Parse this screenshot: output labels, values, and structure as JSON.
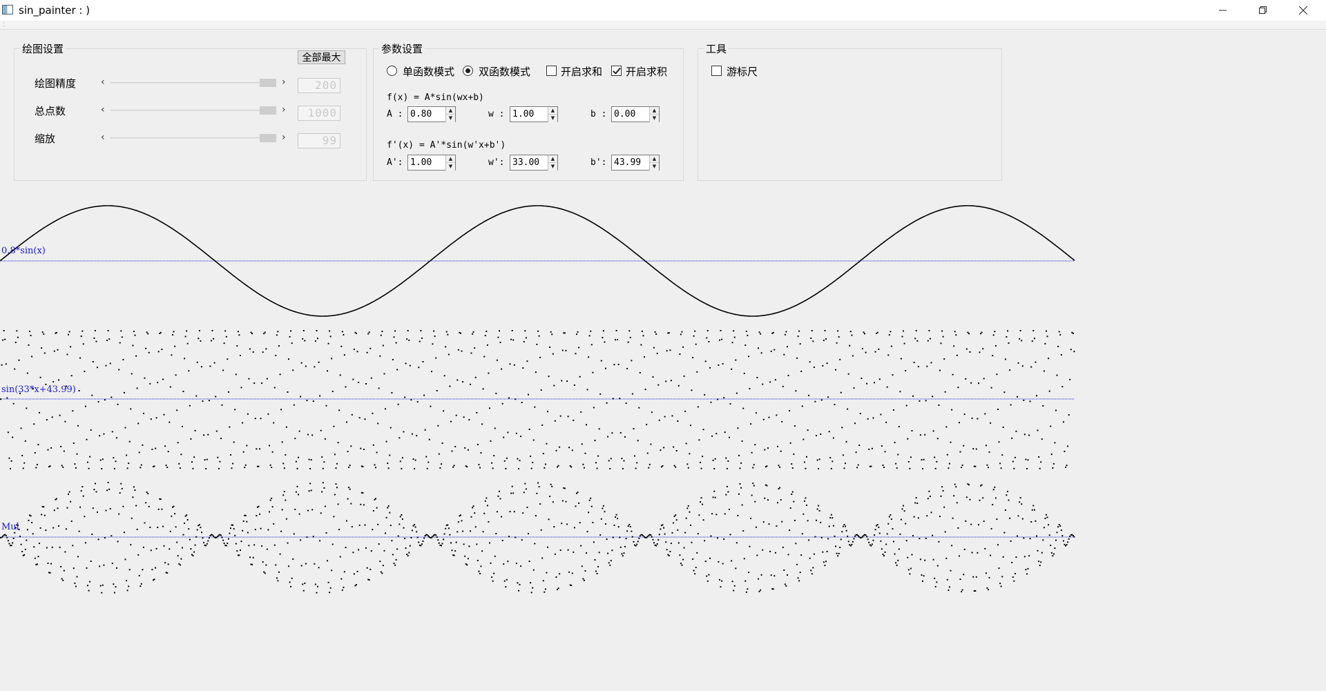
{
  "window": {
    "title": "sin_painter : )"
  },
  "draw_settings": {
    "title": "绘图设置",
    "max_all_button": "全部最大",
    "rows": [
      {
        "label": "绘图精度",
        "display": "200"
      },
      {
        "label": "总点数",
        "display": "1000"
      },
      {
        "label": "缩放",
        "display": "99"
      }
    ]
  },
  "params": {
    "title": "参数设置",
    "mode_single": "单函数模式",
    "mode_double": "双函数模式",
    "enable_sum": "开启求和",
    "enable_product": "开启求积",
    "mode_selected": "双函数模式",
    "sum_checked": false,
    "product_checked": true,
    "f_formula": "f(x) = A*sin(wx+b)",
    "f_prime_formula": "f'(x) = A'*sin(w'x+b')",
    "f": {
      "A_label": "A :",
      "A": "0.80",
      "w_label": "w :",
      "w": "1.00",
      "b_label": "b :",
      "b": "0.00"
    },
    "f_prime": {
      "A_label": "A':",
      "A": "1.00",
      "w_label": "w':",
      "w": "33.00",
      "b_label": "b':",
      "b": "43.99"
    }
  },
  "tools": {
    "title": "工具",
    "vernier_label": "游标尺",
    "vernier_checked": false
  },
  "plots": {
    "line_color": "#1a1ad8",
    "curve_color": "#000000",
    "f_label": "0.8*sin(x)",
    "f_prime_label": "sin(33*x+43.99)",
    "mul_label": "Mul"
  },
  "chart_data": [
    {
      "type": "line",
      "series": [
        {
          "name": "0.8*sin(x)",
          "function": "0.8*sin(x)"
        }
      ],
      "x_range": [
        0,
        15.7
      ],
      "ylim": [
        -0.8,
        0.8
      ]
    },
    {
      "type": "scatter",
      "series": [
        {
          "name": "sin(33*x+43.99)",
          "function": "sin(33*x+43.99)"
        }
      ],
      "x_range": [
        0,
        15.7
      ],
      "points": 1000,
      "ylim": [
        -1,
        1
      ]
    },
    {
      "type": "scatter",
      "series": [
        {
          "name": "Mul",
          "function": "0.8*sin(x)*sin(33*x+43.99)"
        }
      ],
      "x_range": [
        0,
        15.7
      ],
      "points": 1000,
      "ylim": [
        -0.8,
        0.8
      ]
    }
  ]
}
